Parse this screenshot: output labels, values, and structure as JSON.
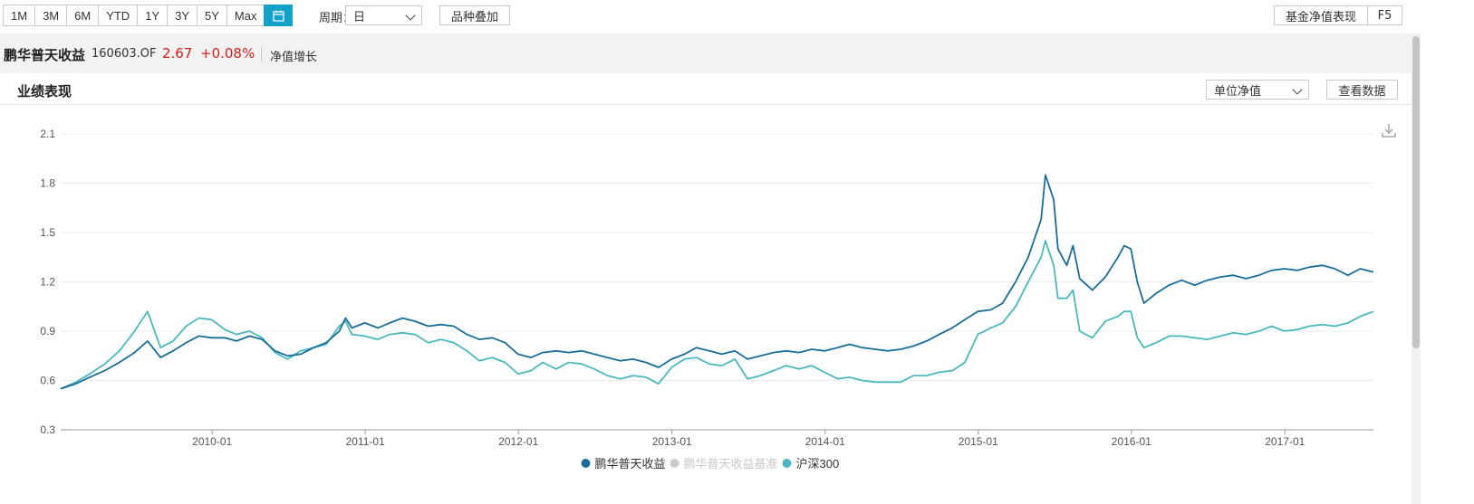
{
  "toolbar": {
    "ranges": [
      "1M",
      "3M",
      "6M",
      "YTD",
      "1Y",
      "3Y",
      "5Y",
      "Max"
    ],
    "period_label": "周期：",
    "period_value": "日",
    "overlay_button": "品种叠加",
    "perf_button": "基金净值表现",
    "f5_button": "F5",
    "active_color": "#13a0c9"
  },
  "fund": {
    "name": "鹏华普天收益",
    "code": "160603.OF",
    "nav": "2.67",
    "change": "+0.08%",
    "metric": "净值增长",
    "change_color": "#d0201a"
  },
  "panel": {
    "title": "业绩表现",
    "unit_select": "单位净值",
    "view_data_button": "查看数据"
  },
  "chart_data": {
    "type": "line",
    "title": "",
    "xlabel": "",
    "ylabel": "",
    "ylim": [
      0.3,
      2.1
    ],
    "yticks": [
      0.3,
      0.6,
      0.9,
      1.2,
      1.5,
      1.8,
      2.1
    ],
    "xlim": [
      "2009-01-05",
      "2017-07-31"
    ],
    "xticks": [
      "2010-01",
      "2011-01",
      "2012-01",
      "2013-01",
      "2014-01",
      "2015-01",
      "2016-01",
      "2017-01"
    ],
    "grid": true,
    "legend_position": "bottom-center",
    "series": [
      {
        "name": "鹏华普天收益",
        "color": "#1a6d98",
        "visible": true,
        "points": [
          [
            "2009-01-05",
            0.55
          ],
          [
            "2009-02-10",
            0.58
          ],
          [
            "2009-03-15",
            0.62
          ],
          [
            "2009-04-20",
            0.66
          ],
          [
            "2009-05-25",
            0.71
          ],
          [
            "2009-06-30",
            0.77
          ],
          [
            "2009-07-31",
            0.84
          ],
          [
            "2009-08-31",
            0.74
          ],
          [
            "2009-09-30",
            0.78
          ],
          [
            "2009-10-31",
            0.83
          ],
          [
            "2009-11-30",
            0.87
          ],
          [
            "2009-12-31",
            0.86
          ],
          [
            "2010-01-31",
            0.86
          ],
          [
            "2010-02-28",
            0.84
          ],
          [
            "2010-03-31",
            0.87
          ],
          [
            "2010-04-30",
            0.85
          ],
          [
            "2010-05-31",
            0.78
          ],
          [
            "2010-06-30",
            0.75
          ],
          [
            "2010-07-31",
            0.76
          ],
          [
            "2010-08-31",
            0.8
          ],
          [
            "2010-09-30",
            0.83
          ],
          [
            "2010-10-31",
            0.9
          ],
          [
            "2010-11-15",
            0.98
          ],
          [
            "2010-11-30",
            0.92
          ],
          [
            "2010-12-31",
            0.95
          ],
          [
            "2011-01-31",
            0.92
          ],
          [
            "2011-02-28",
            0.95
          ],
          [
            "2011-03-31",
            0.98
          ],
          [
            "2011-04-30",
            0.96
          ],
          [
            "2011-05-31",
            0.93
          ],
          [
            "2011-06-30",
            0.94
          ],
          [
            "2011-07-31",
            0.93
          ],
          [
            "2011-08-31",
            0.88
          ],
          [
            "2011-09-30",
            0.85
          ],
          [
            "2011-10-31",
            0.86
          ],
          [
            "2011-11-30",
            0.83
          ],
          [
            "2011-12-31",
            0.76
          ],
          [
            "2012-01-31",
            0.74
          ],
          [
            "2012-02-28",
            0.77
          ],
          [
            "2012-03-31",
            0.78
          ],
          [
            "2012-04-30",
            0.77
          ],
          [
            "2012-05-31",
            0.78
          ],
          [
            "2012-06-30",
            0.76
          ],
          [
            "2012-07-31",
            0.74
          ],
          [
            "2012-08-31",
            0.72
          ],
          [
            "2012-09-30",
            0.73
          ],
          [
            "2012-10-31",
            0.71
          ],
          [
            "2012-11-30",
            0.68
          ],
          [
            "2012-12-31",
            0.73
          ],
          [
            "2013-01-31",
            0.76
          ],
          [
            "2013-02-28",
            0.8
          ],
          [
            "2013-03-31",
            0.78
          ],
          [
            "2013-04-30",
            0.76
          ],
          [
            "2013-05-31",
            0.78
          ],
          [
            "2013-06-30",
            0.73
          ],
          [
            "2013-07-31",
            0.75
          ],
          [
            "2013-08-31",
            0.77
          ],
          [
            "2013-09-30",
            0.78
          ],
          [
            "2013-10-31",
            0.77
          ],
          [
            "2013-11-30",
            0.79
          ],
          [
            "2013-12-31",
            0.78
          ],
          [
            "2014-01-31",
            0.8
          ],
          [
            "2014-02-28",
            0.82
          ],
          [
            "2014-03-31",
            0.8
          ],
          [
            "2014-04-30",
            0.79
          ],
          [
            "2014-05-31",
            0.78
          ],
          [
            "2014-06-30",
            0.79
          ],
          [
            "2014-07-31",
            0.81
          ],
          [
            "2014-08-31",
            0.84
          ],
          [
            "2014-09-30",
            0.88
          ],
          [
            "2014-10-31",
            0.92
          ],
          [
            "2014-11-30",
            0.97
          ],
          [
            "2014-12-31",
            1.02
          ],
          [
            "2015-01-31",
            1.03
          ],
          [
            "2015-02-28",
            1.07
          ],
          [
            "2015-03-31",
            1.2
          ],
          [
            "2015-04-30",
            1.35
          ],
          [
            "2015-05-31",
            1.58
          ],
          [
            "2015-06-10",
            1.85
          ],
          [
            "2015-06-30",
            1.7
          ],
          [
            "2015-07-10",
            1.4
          ],
          [
            "2015-07-31",
            1.3
          ],
          [
            "2015-08-15",
            1.42
          ],
          [
            "2015-08-31",
            1.22
          ],
          [
            "2015-09-30",
            1.15
          ],
          [
            "2015-10-31",
            1.23
          ],
          [
            "2015-11-30",
            1.35
          ],
          [
            "2015-12-15",
            1.42
          ],
          [
            "2015-12-31",
            1.4
          ],
          [
            "2016-01-15",
            1.2
          ],
          [
            "2016-01-31",
            1.07
          ],
          [
            "2016-02-29",
            1.13
          ],
          [
            "2016-03-31",
            1.18
          ],
          [
            "2016-04-30",
            1.21
          ],
          [
            "2016-05-31",
            1.18
          ],
          [
            "2016-06-30",
            1.21
          ],
          [
            "2016-07-31",
            1.23
          ],
          [
            "2016-08-31",
            1.24
          ],
          [
            "2016-09-30",
            1.22
          ],
          [
            "2016-10-31",
            1.24
          ],
          [
            "2016-11-30",
            1.27
          ],
          [
            "2016-12-31",
            1.28
          ],
          [
            "2017-01-31",
            1.27
          ],
          [
            "2017-02-28",
            1.29
          ],
          [
            "2017-03-31",
            1.3
          ],
          [
            "2017-04-30",
            1.28
          ],
          [
            "2017-05-31",
            1.24
          ],
          [
            "2017-06-30",
            1.28
          ],
          [
            "2017-07-31",
            1.26
          ]
        ]
      },
      {
        "name": "鹏华普天收益基准",
        "color": "#cccccc",
        "visible": false,
        "points": []
      },
      {
        "name": "沪深300",
        "color": "#4bb8bd",
        "visible": true,
        "points": [
          [
            "2009-01-05",
            0.55
          ],
          [
            "2009-02-10",
            0.59
          ],
          [
            "2009-03-15",
            0.64
          ],
          [
            "2009-04-20",
            0.7
          ],
          [
            "2009-05-25",
            0.78
          ],
          [
            "2009-06-30",
            0.9
          ],
          [
            "2009-07-31",
            1.02
          ],
          [
            "2009-08-31",
            0.8
          ],
          [
            "2009-09-30",
            0.84
          ],
          [
            "2009-10-31",
            0.93
          ],
          [
            "2009-11-30",
            0.98
          ],
          [
            "2009-12-31",
            0.97
          ],
          [
            "2010-01-31",
            0.91
          ],
          [
            "2010-02-28",
            0.88
          ],
          [
            "2010-03-31",
            0.9
          ],
          [
            "2010-04-30",
            0.86
          ],
          [
            "2010-05-31",
            0.77
          ],
          [
            "2010-06-30",
            0.73
          ],
          [
            "2010-07-31",
            0.78
          ],
          [
            "2010-08-31",
            0.8
          ],
          [
            "2010-09-30",
            0.82
          ],
          [
            "2010-10-31",
            0.93
          ],
          [
            "2010-11-15",
            0.96
          ],
          [
            "2010-11-30",
            0.88
          ],
          [
            "2010-12-31",
            0.87
          ],
          [
            "2011-01-31",
            0.85
          ],
          [
            "2011-02-28",
            0.88
          ],
          [
            "2011-03-31",
            0.89
          ],
          [
            "2011-04-30",
            0.88
          ],
          [
            "2011-05-31",
            0.83
          ],
          [
            "2011-06-30",
            0.85
          ],
          [
            "2011-07-31",
            0.83
          ],
          [
            "2011-08-31",
            0.78
          ],
          [
            "2011-09-30",
            0.72
          ],
          [
            "2011-10-31",
            0.74
          ],
          [
            "2011-11-30",
            0.71
          ],
          [
            "2011-12-31",
            0.64
          ],
          [
            "2012-01-31",
            0.66
          ],
          [
            "2012-02-28",
            0.71
          ],
          [
            "2012-03-31",
            0.67
          ],
          [
            "2012-04-30",
            0.71
          ],
          [
            "2012-05-31",
            0.7
          ],
          [
            "2012-06-30",
            0.67
          ],
          [
            "2012-07-31",
            0.63
          ],
          [
            "2012-08-31",
            0.61
          ],
          [
            "2012-09-30",
            0.63
          ],
          [
            "2012-10-31",
            0.62
          ],
          [
            "2012-11-30",
            0.58
          ],
          [
            "2012-12-31",
            0.68
          ],
          [
            "2013-01-31",
            0.73
          ],
          [
            "2013-02-28",
            0.74
          ],
          [
            "2013-03-31",
            0.7
          ],
          [
            "2013-04-30",
            0.69
          ],
          [
            "2013-05-31",
            0.73
          ],
          [
            "2013-06-30",
            0.61
          ],
          [
            "2013-07-31",
            0.63
          ],
          [
            "2013-08-31",
            0.66
          ],
          [
            "2013-09-30",
            0.69
          ],
          [
            "2013-10-31",
            0.67
          ],
          [
            "2013-11-30",
            0.69
          ],
          [
            "2013-12-31",
            0.65
          ],
          [
            "2014-01-31",
            0.61
          ],
          [
            "2014-02-28",
            0.62
          ],
          [
            "2014-03-31",
            0.6
          ],
          [
            "2014-04-30",
            0.59
          ],
          [
            "2014-05-31",
            0.59
          ],
          [
            "2014-06-30",
            0.59
          ],
          [
            "2014-07-31",
            0.63
          ],
          [
            "2014-08-31",
            0.63
          ],
          [
            "2014-09-30",
            0.65
          ],
          [
            "2014-10-31",
            0.66
          ],
          [
            "2014-11-30",
            0.71
          ],
          [
            "2014-12-31",
            0.88
          ],
          [
            "2015-01-31",
            0.92
          ],
          [
            "2015-02-28",
            0.95
          ],
          [
            "2015-03-31",
            1.05
          ],
          [
            "2015-04-30",
            1.2
          ],
          [
            "2015-05-31",
            1.35
          ],
          [
            "2015-06-10",
            1.45
          ],
          [
            "2015-06-30",
            1.3
          ],
          [
            "2015-07-10",
            1.1
          ],
          [
            "2015-07-31",
            1.1
          ],
          [
            "2015-08-15",
            1.15
          ],
          [
            "2015-08-31",
            0.9
          ],
          [
            "2015-09-30",
            0.86
          ],
          [
            "2015-10-31",
            0.96
          ],
          [
            "2015-11-30",
            0.99
          ],
          [
            "2015-12-15",
            1.02
          ],
          [
            "2015-12-31",
            1.02
          ],
          [
            "2016-01-15",
            0.86
          ],
          [
            "2016-01-31",
            0.8
          ],
          [
            "2016-02-29",
            0.83
          ],
          [
            "2016-03-31",
            0.87
          ],
          [
            "2016-04-30",
            0.87
          ],
          [
            "2016-05-31",
            0.86
          ],
          [
            "2016-06-30",
            0.85
          ],
          [
            "2016-07-31",
            0.87
          ],
          [
            "2016-08-31",
            0.89
          ],
          [
            "2016-09-30",
            0.88
          ],
          [
            "2016-10-31",
            0.9
          ],
          [
            "2016-11-30",
            0.93
          ],
          [
            "2016-12-31",
            0.9
          ],
          [
            "2017-01-31",
            0.91
          ],
          [
            "2017-02-28",
            0.93
          ],
          [
            "2017-03-31",
            0.94
          ],
          [
            "2017-04-30",
            0.93
          ],
          [
            "2017-05-31",
            0.95
          ],
          [
            "2017-06-30",
            0.99
          ],
          [
            "2017-07-31",
            1.02
          ]
        ]
      }
    ]
  }
}
